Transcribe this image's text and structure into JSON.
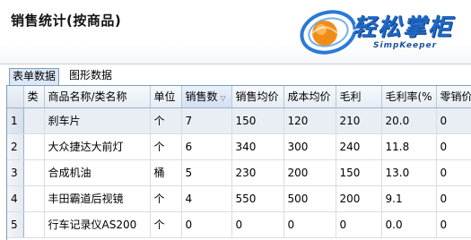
{
  "header": {
    "title": "销售统计(按商品)",
    "logo_text": "轻松掌柜",
    "logo_subtitle": "SimpKeeper"
  },
  "tabs": [
    {
      "label": "表单数据",
      "active": true
    },
    {
      "label": "图形数据",
      "active": false
    }
  ],
  "table": {
    "columns": [
      "类",
      "商品名称/类名称",
      "单位",
      "销售数",
      "销售均价",
      "成本均价",
      "毛利",
      "毛利率(%",
      "零销价"
    ],
    "sorted_column": "销售数",
    "rows": [
      {
        "no": "1",
        "cat": "",
        "name": "刹车片",
        "unit": "个",
        "qty": "7",
        "avg_price": "150",
        "avg_cost": "120",
        "profit": "210",
        "margin": "20.0",
        "retail": "0"
      },
      {
        "no": "2",
        "cat": "",
        "name": "大众捷达大前灯",
        "unit": "个",
        "qty": "6",
        "avg_price": "340",
        "avg_cost": "300",
        "profit": "240",
        "margin": "11.8",
        "retail": "0"
      },
      {
        "no": "3",
        "cat": "",
        "name": "合成机油",
        "unit": "桶",
        "qty": "5",
        "avg_price": "230",
        "avg_cost": "200",
        "profit": "150",
        "margin": "13.0",
        "retail": "0"
      },
      {
        "no": "4",
        "cat": "",
        "name": "丰田霸道后视镜",
        "unit": "个",
        "qty": "4",
        "avg_price": "550",
        "avg_cost": "500",
        "profit": "200",
        "margin": "9.1",
        "retail": "0"
      },
      {
        "no": "5",
        "cat": "",
        "name": "行车记录仪AS200",
        "unit": "个",
        "qty": "0",
        "avg_price": "0",
        "avg_cost": "0",
        "profit": "0",
        "margin": "0.0",
        "retail": "0"
      }
    ]
  },
  "colors": {
    "logo_blue": "#1f68c7",
    "logo_orange": "#f28c18",
    "header_border": "#7f9db9"
  }
}
